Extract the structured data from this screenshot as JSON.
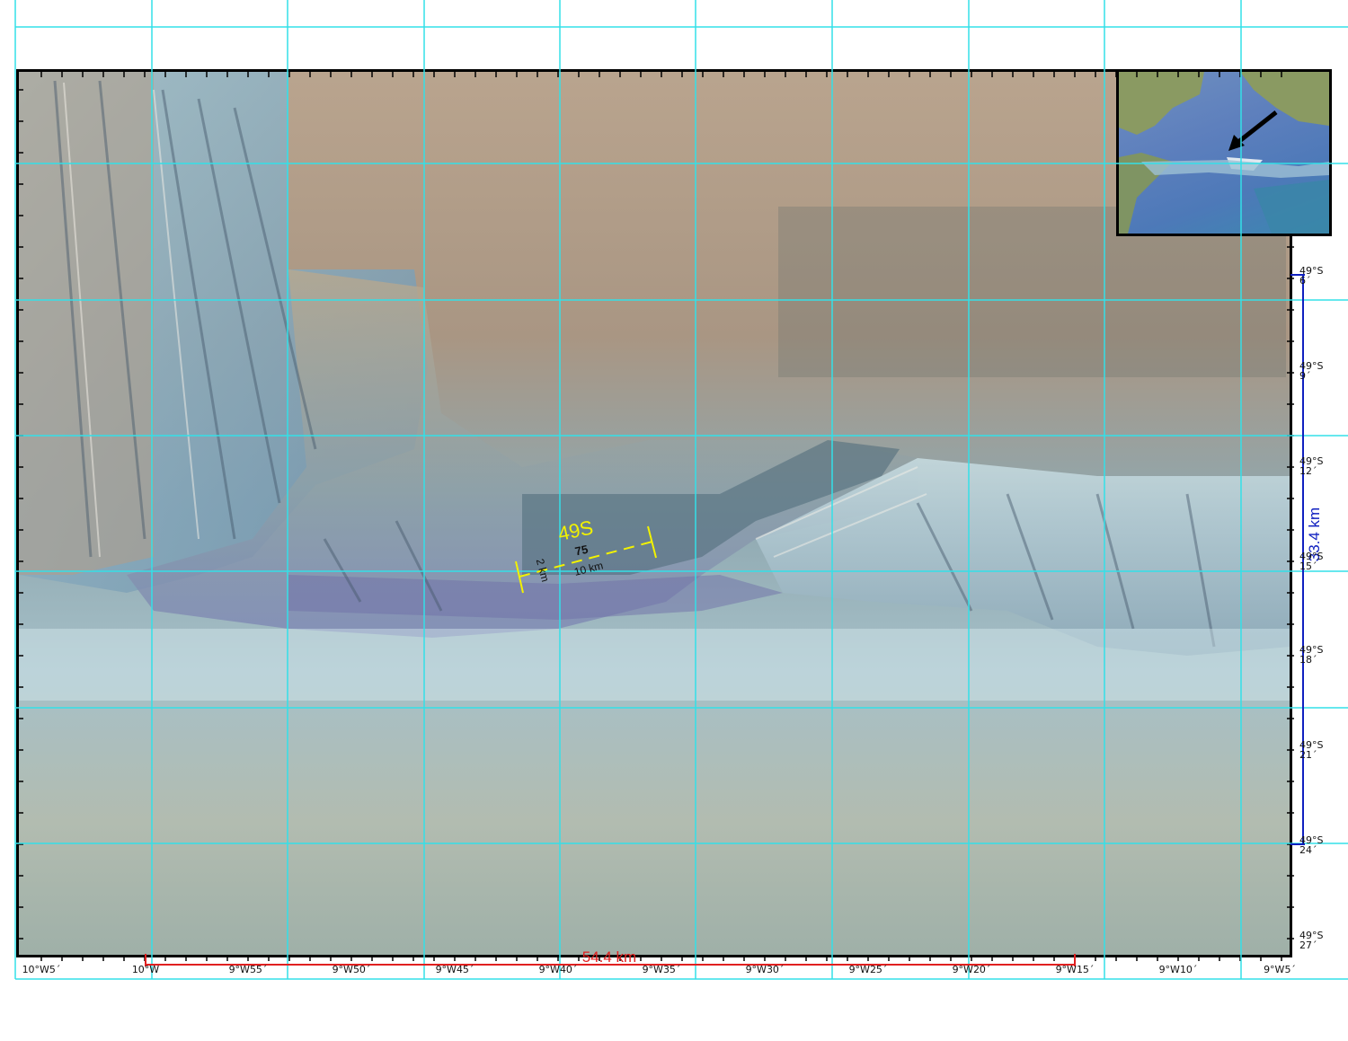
{
  "feature_label": "49S",
  "feature_annotation": {
    "number": "75",
    "length": "10 km",
    "width": "2 km"
  },
  "scale_bars": {
    "horizontal": "54.4 km",
    "vertical": "33.4 km"
  },
  "longitude_labels": [
    "10°W5´",
    "10°W",
    "9°W55´",
    "9°W50´",
    "9°W45´",
    "9°W40´",
    "9°W35´",
    "9°W30´",
    "9°W25´",
    "9°W20´",
    "9°W15´",
    "9°W10´",
    "9°W5´"
  ],
  "latitude_labels": [
    {
      "deg": "49°S",
      "min": "6´"
    },
    {
      "deg": "49°S",
      "min": "9´"
    },
    {
      "deg": "49°S",
      "min": "12´"
    },
    {
      "deg": "49°S",
      "min": "15´"
    },
    {
      "deg": "49°S",
      "min": "18´"
    },
    {
      "deg": "49°S",
      "min": "21´"
    },
    {
      "deg": "49°S",
      "min": "24´"
    },
    {
      "deg": "49°S",
      "min": "27´"
    }
  ],
  "colors": {
    "grid": "#33e0e8",
    "feature_label": "#f2f200",
    "horizontal_scale": "#e02020",
    "vertical_scale": "#1020c0"
  },
  "icons": [
    "inset-map",
    "location-arrow-icon"
  ]
}
